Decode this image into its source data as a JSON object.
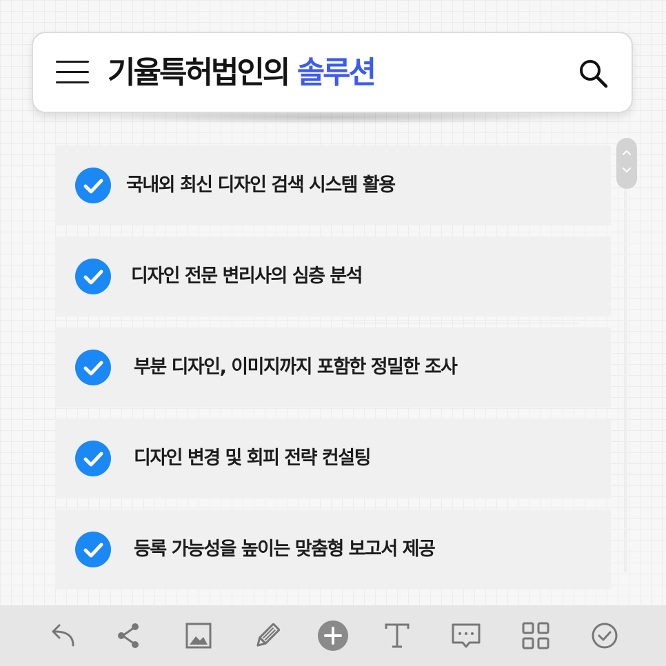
{
  "header": {
    "title_main": "기율특허법인의",
    "title_accent": "솔루션",
    "accent_color": "#3c5cf0",
    "menu_icon": "hamburger-menu-icon",
    "search_icon": "search-icon"
  },
  "solutions": {
    "check_color": "#1a88f5",
    "items": [
      {
        "label": "국내외 최신 디자인 검색 시스템 활용"
      },
      {
        "label": "디자인 전문 변리사의 심층 분석"
      },
      {
        "label": "부분 디자인, 이미지까지 포함한 정밀한 조사"
      },
      {
        "label": "디자인 변경 및 회피 전략 컨설팅"
      },
      {
        "label": "등록 가능성을 높이는 맞춤형 보고서 제공"
      }
    ]
  },
  "toolbar": {
    "tools": [
      "undo-icon",
      "share-icon",
      "image-icon",
      "pencil-icon",
      "add-icon",
      "text-icon",
      "comment-icon",
      "grid-icon",
      "check-circle-icon"
    ]
  }
}
